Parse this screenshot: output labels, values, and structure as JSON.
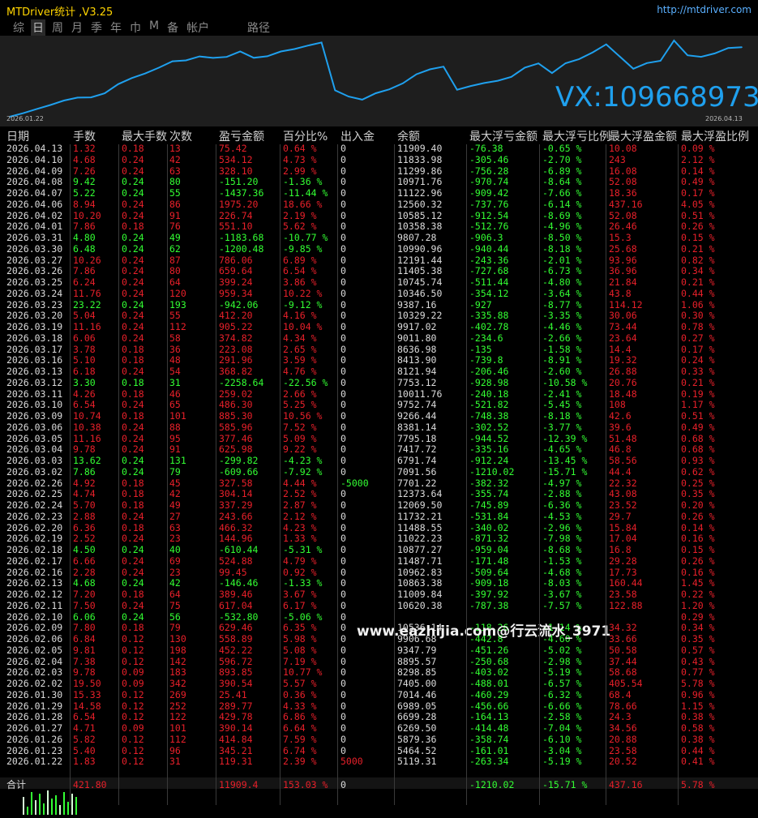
{
  "app": {
    "title": "MTDriver统计 ,V3.25",
    "url": "http://mtdriver.com",
    "tabs": [
      "综",
      "日",
      "周",
      "月",
      "季",
      "年",
      "巾",
      "M",
      "备",
      "帐户"
    ],
    "active_tab": 1,
    "path_label": "路径",
    "contact": "VX:1096689731",
    "chart_start_date": "2026.01.22",
    "chart_end_date": "2026.04.13",
    "watermark": "www.eazhijia.com@行云流水_3971"
  },
  "colors": {
    "profit": "#e8202a",
    "loss": "#33ff33",
    "curve": "#1fa0ee",
    "text": "#dcdcdc"
  },
  "chart_data": {
    "type": "line",
    "title": "",
    "xlabel": "",
    "ylabel": "",
    "x_range": [
      "2026.01.22",
      "2026.04.13"
    ],
    "series": [
      {
        "values": [
          5119.31,
          5464.52,
          5879.36,
          6269.5,
          6699.28,
          6989.05,
          7014.46,
          7405.0,
          8298.85,
          8895.57,
          9347.79,
          9906.68,
          10536.14,
          10620.38,
          11009.84,
          10863.38,
          10962.83,
          11487.71,
          10877.27,
          11022.23,
          11488.55,
          11732.21,
          12069.5,
          12373.64,
          7701.22,
          7091.56,
          6791.74,
          7417.72,
          7795.18,
          8381.14,
          9266.44,
          9752.74,
          10011.76,
          7753.12,
          8121.94,
          8413.9,
          8636.98,
          9011.8,
          9917.02,
          10329.22,
          9387.16,
          10346.5,
          10745.74,
          11405.38,
          12191.44,
          10990.96,
          9807.28,
          10358.38,
          10585.12,
          12560.32,
          11122.96,
          10971.76,
          11299.86,
          11833.98,
          11909.4
        ]
      }
    ]
  },
  "table": {
    "headers": [
      "日期",
      "手数",
      "最大手数",
      "次数",
      "盈亏金额",
      "百分比%",
      "出入金",
      "余额",
      "最大浮亏金额",
      "最大浮亏比例",
      "最大浮盈金额",
      "最大浮盈比例"
    ],
    "rows": [
      [
        "2026.04.13",
        "1.32",
        "0.18",
        "13",
        "75.42",
        "0.64 %",
        "0",
        "11909.40",
        "-76.38",
        "-0.65 %",
        "10.08",
        "0.09 %"
      ],
      [
        "2026.04.10",
        "4.68",
        "0.24",
        "42",
        "534.12",
        "4.73 %",
        "0",
        "11833.98",
        "-305.46",
        "-2.70 %",
        "243",
        "2.12 %"
      ],
      [
        "2026.04.09",
        "7.26",
        "0.24",
        "63",
        "328.10",
        "2.99 %",
        "0",
        "11299.86",
        "-756.28",
        "-6.89 %",
        "16.08",
        "0.14 %"
      ],
      [
        "2026.04.08",
        "9.42",
        "0.24",
        "80",
        "-151.20",
        "-1.36 %",
        "0",
        "10971.76",
        "-970.74",
        "-8.64 %",
        "52.08",
        "0.49 %"
      ],
      [
        "2026.04.07",
        "5.22",
        "0.24",
        "55",
        "-1437.36",
        "-11.44 %",
        "0",
        "11122.96",
        "-909.42",
        "-7.66 %",
        "18.36",
        "0.17 %"
      ],
      [
        "2026.04.06",
        "8.94",
        "0.24",
        "86",
        "1975.20",
        "18.66 %",
        "0",
        "12560.32",
        "-737.76",
        "-6.14 %",
        "437.16",
        "4.05 %"
      ],
      [
        "2026.04.02",
        "10.20",
        "0.24",
        "91",
        "226.74",
        "2.19 %",
        "0",
        "10585.12",
        "-912.54",
        "-8.69 %",
        "52.08",
        "0.51 %"
      ],
      [
        "2026.04.01",
        "7.86",
        "0.18",
        "76",
        "551.10",
        "5.62 %",
        "0",
        "10358.38",
        "-512.76",
        "-4.96 %",
        "26.46",
        "0.26 %"
      ],
      [
        "2026.03.31",
        "4.80",
        "0.24",
        "49",
        "-1183.68",
        "-10.77 %",
        "0",
        "9807.28",
        "-906.3",
        "-8.50 %",
        "15.3",
        "0.15 %"
      ],
      [
        "2026.03.30",
        "6.48",
        "0.24",
        "62",
        "-1200.48",
        "-9.85 %",
        "0",
        "10990.96",
        "-940.44",
        "-8.18 %",
        "25.68",
        "0.21 %"
      ],
      [
        "2026.03.27",
        "10.26",
        "0.24",
        "87",
        "786.06",
        "6.89 %",
        "0",
        "12191.44",
        "-243.36",
        "-2.01 %",
        "93.96",
        "0.82 %"
      ],
      [
        "2026.03.26",
        "7.86",
        "0.24",
        "80",
        "659.64",
        "6.54 %",
        "0",
        "11405.38",
        "-727.68",
        "-6.73 %",
        "36.96",
        "0.34 %"
      ],
      [
        "2026.03.25",
        "6.24",
        "0.24",
        "64",
        "399.24",
        "3.86 %",
        "0",
        "10745.74",
        "-511.44",
        "-4.80 %",
        "21.84",
        "0.21 %"
      ],
      [
        "2026.03.24",
        "11.76",
        "0.24",
        "120",
        "959.34",
        "10.22 %",
        "0",
        "10346.50",
        "-354.12",
        "-3.64 %",
        "43.8",
        "0.44 %"
      ],
      [
        "2026.03.23",
        "23.22",
        "0.24",
        "193",
        "-942.06",
        "-9.12 %",
        "0",
        "9387.16",
        "-927",
        "-8.77 %",
        "114.12",
        "1.06 %"
      ],
      [
        "2026.03.20",
        "5.04",
        "0.24",
        "55",
        "412.20",
        "4.16 %",
        "0",
        "10329.22",
        "-335.88",
        "-3.35 %",
        "30.06",
        "0.30 %"
      ],
      [
        "2026.03.19",
        "11.16",
        "0.24",
        "112",
        "905.22",
        "10.04 %",
        "0",
        "9917.02",
        "-402.78",
        "-4.46 %",
        "73.44",
        "0.78 %"
      ],
      [
        "2026.03.18",
        "6.06",
        "0.24",
        "58",
        "374.82",
        "4.34 %",
        "0",
        "9011.80",
        "-234.6",
        "-2.66 %",
        "23.64",
        "0.27 %"
      ],
      [
        "2026.03.17",
        "3.78",
        "0.18",
        "36",
        "223.08",
        "2.65 %",
        "0",
        "8636.98",
        "-135",
        "-1.58 %",
        "14.4",
        "0.17 %"
      ],
      [
        "2026.03.16",
        "5.10",
        "0.18",
        "48",
        "291.96",
        "3.59 %",
        "0",
        "8413.90",
        "-739.8",
        "-8.91 %",
        "19.32",
        "0.24 %"
      ],
      [
        "2026.03.13",
        "6.18",
        "0.24",
        "54",
        "368.82",
        "4.76 %",
        "0",
        "8121.94",
        "-206.46",
        "-2.60 %",
        "26.88",
        "0.33 %"
      ],
      [
        "2026.03.12",
        "3.30",
        "0.18",
        "31",
        "-2258.64",
        "-22.56 %",
        "0",
        "7753.12",
        "-928.98",
        "-10.58 %",
        "20.76",
        "0.21 %"
      ],
      [
        "2026.03.11",
        "4.26",
        "0.18",
        "46",
        "259.02",
        "2.66 %",
        "0",
        "10011.76",
        "-240.18",
        "-2.41 %",
        "18.48",
        "0.19 %"
      ],
      [
        "2026.03.10",
        "6.54",
        "0.24",
        "65",
        "486.30",
        "5.25 %",
        "0",
        "9752.74",
        "-521.82",
        "-5.45 %",
        "108",
        "1.17 %"
      ],
      [
        "2026.03.09",
        "10.74",
        "0.18",
        "101",
        "885.30",
        "10.56 %",
        "0",
        "9266.44",
        "-748.38",
        "-8.18 %",
        "42.6",
        "0.51 %"
      ],
      [
        "2026.03.06",
        "10.38",
        "0.24",
        "88",
        "585.96",
        "7.52 %",
        "0",
        "8381.14",
        "-302.52",
        "-3.77 %",
        "39.6",
        "0.49 %"
      ],
      [
        "2026.03.05",
        "11.16",
        "0.24",
        "95",
        "377.46",
        "5.09 %",
        "0",
        "7795.18",
        "-944.52",
        "-12.39 %",
        "51.48",
        "0.68 %"
      ],
      [
        "2026.03.04",
        "9.78",
        "0.24",
        "91",
        "625.98",
        "9.22 %",
        "0",
        "7417.72",
        "-335.16",
        "-4.65 %",
        "46.8",
        "0.68 %"
      ],
      [
        "2026.03.03",
        "13.62",
        "0.24",
        "131",
        "-299.82",
        "-4.23 %",
        "0",
        "6791.74",
        "-912.24",
        "-13.45 %",
        "58.56",
        "0.93 %"
      ],
      [
        "2026.03.02",
        "7.86",
        "0.24",
        "79",
        "-609.66",
        "-7.92 %",
        "0",
        "7091.56",
        "-1210.02",
        "-15.71 %",
        "44.4",
        "0.62 %"
      ],
      [
        "2026.02.26",
        "4.92",
        "0.18",
        "45",
        "327.58",
        "4.44 %",
        "-5000",
        "7701.22",
        "-382.32",
        "-4.97 %",
        "22.32",
        "0.25 %"
      ],
      [
        "2026.02.25",
        "4.74",
        "0.18",
        "42",
        "304.14",
        "2.52 %",
        "0",
        "12373.64",
        "-355.74",
        "-2.88 %",
        "43.08",
        "0.35 %"
      ],
      [
        "2026.02.24",
        "5.70",
        "0.18",
        "49",
        "337.29",
        "2.87 %",
        "0",
        "12069.50",
        "-745.89",
        "-6.36 %",
        "23.52",
        "0.20 %"
      ],
      [
        "2026.02.23",
        "2.88",
        "0.24",
        "27",
        "243.66",
        "2.12 %",
        "0",
        "11732.21",
        "-531.84",
        "-4.53 %",
        "29.7",
        "0.26 %"
      ],
      [
        "2026.02.20",
        "6.36",
        "0.18",
        "63",
        "466.32",
        "4.23 %",
        "0",
        "11488.55",
        "-340.02",
        "-2.96 %",
        "15.84",
        "0.14 %"
      ],
      [
        "2026.02.19",
        "2.52",
        "0.24",
        "23",
        "144.96",
        "1.33 %",
        "0",
        "11022.23",
        "-871.32",
        "-7.98 %",
        "17.04",
        "0.16 %"
      ],
      [
        "2026.02.18",
        "4.50",
        "0.24",
        "40",
        "-610.44",
        "-5.31 %",
        "0",
        "10877.27",
        "-959.04",
        "-8.68 %",
        "16.8",
        "0.15 %"
      ],
      [
        "2026.02.17",
        "6.66",
        "0.24",
        "69",
        "524.88",
        "4.79 %",
        "0",
        "11487.71",
        "-171.48",
        "-1.53 %",
        "29.28",
        "0.26 %"
      ],
      [
        "2026.02.16",
        "2.28",
        "0.24",
        "23",
        "99.45",
        "0.92 %",
        "0",
        "10962.83",
        "-509.64",
        "-4.68 %",
        "17.73",
        "0.16 %"
      ],
      [
        "2026.02.13",
        "4.68",
        "0.24",
        "42",
        "-146.46",
        "-1.33 %",
        "0",
        "10863.38",
        "-909.18",
        "-8.03 %",
        "160.44",
        "1.45 %"
      ],
      [
        "2026.02.12",
        "7.20",
        "0.18",
        "64",
        "389.46",
        "3.67 %",
        "0",
        "11009.84",
        "-397.92",
        "-3.67 %",
        "23.58",
        "0.22 %"
      ],
      [
        "2026.02.11",
        "7.50",
        "0.24",
        "75",
        "617.04",
        "6.17 %",
        "0",
        "10620.38",
        "-787.38",
        "-7.57 %",
        "122.88",
        "1.20 %"
      ],
      [
        "2026.02.10",
        "6.06",
        "0.24",
        "56",
        "-532.80",
        "-5.06 %",
        "0",
        "",
        "",
        "",
        "",
        "0.29 %"
      ],
      [
        "2026.02.09",
        "7.80",
        "0.18",
        "79",
        "629.46",
        "6.35 %",
        "0",
        "10536.14",
        "-118.26",
        "-1.14 %",
        "34.32",
        "0.34 %"
      ],
      [
        "2026.02.06",
        "6.84",
        "0.12",
        "130",
        "558.89",
        "5.98 %",
        "0",
        "9906.68",
        "-442.8",
        "-4.60 %",
        "33.66",
        "0.35 %"
      ],
      [
        "2026.02.05",
        "9.81",
        "0.12",
        "198",
        "452.22",
        "5.08 %",
        "0",
        "9347.79",
        "-451.26",
        "-5.02 %",
        "50.58",
        "0.57 %"
      ],
      [
        "2026.02.04",
        "7.38",
        "0.12",
        "142",
        "596.72",
        "7.19 %",
        "0",
        "8895.57",
        "-250.68",
        "-2.98 %",
        "37.44",
        "0.43 %"
      ],
      [
        "2026.02.03",
        "9.78",
        "0.09",
        "183",
        "893.85",
        "10.77 %",
        "0",
        "8298.85",
        "-403.02",
        "-5.19 %",
        "58.68",
        "0.77 %"
      ],
      [
        "2026.02.02",
        "19.50",
        "0.09",
        "342",
        "390.54",
        "5.57 %",
        "0",
        "7405.00",
        "-488.01",
        "-6.57 %",
        "405.54",
        "5.78 %"
      ],
      [
        "2026.01.30",
        "15.33",
        "0.12",
        "269",
        "25.41",
        "0.36 %",
        "0",
        "7014.46",
        "-460.29",
        "-6.32 %",
        "68.4",
        "0.96 %"
      ],
      [
        "2026.01.29",
        "14.58",
        "0.12",
        "252",
        "289.77",
        "4.33 %",
        "0",
        "6989.05",
        "-456.66",
        "-6.66 %",
        "78.66",
        "1.15 %"
      ],
      [
        "2026.01.28",
        "6.54",
        "0.12",
        "122",
        "429.78",
        "6.86 %",
        "0",
        "6699.28",
        "-164.13",
        "-2.58 %",
        "24.3",
        "0.38 %"
      ],
      [
        "2026.01.27",
        "4.71",
        "0.09",
        "101",
        "390.14",
        "6.64 %",
        "0",
        "6269.50",
        "-414.48",
        "-7.04 %",
        "34.56",
        "0.58 %"
      ],
      [
        "2026.01.26",
        "5.82",
        "0.12",
        "112",
        "414.84",
        "7.59 %",
        "0",
        "5879.36",
        "-358.74",
        "-6.10 %",
        "20.88",
        "0.38 %"
      ],
      [
        "2026.01.23",
        "5.40",
        "0.12",
        "96",
        "345.21",
        "6.74 %",
        "0",
        "5464.52",
        "-161.01",
        "-3.04 %",
        "23.58",
        "0.44 %"
      ],
      [
        "2026.01.22",
        "1.83",
        "0.12",
        "31",
        "119.31",
        "2.39 %",
        "5000",
        "5119.31",
        "-263.34",
        "-5.19 %",
        "20.52",
        "0.41 %"
      ]
    ],
    "footer": [
      "合计",
      "421.80",
      "",
      "",
      "11909.4",
      "153.03 %",
      "0",
      "",
      "-1210.02",
      "-15.71 %",
      "437.16",
      "5.78 %"
    ]
  }
}
